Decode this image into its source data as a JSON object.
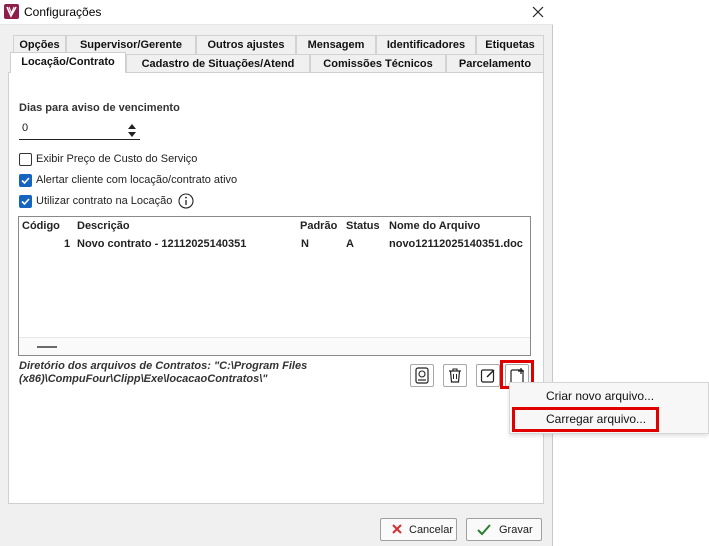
{
  "window": {
    "title": "Configurações"
  },
  "tabs": {
    "row1": [
      "Opções",
      "Supervisor/Gerente",
      "Outros ajustes",
      "Mensagem",
      "Identificadores",
      "Etiquetas"
    ],
    "row2": [
      "Locação/Contrato",
      "Cadastro de Situações/Atend",
      "Comissões Técnicos",
      "Parcelamento"
    ],
    "active": "Locação/Contrato"
  },
  "form": {
    "dias_label": "Dias para aviso de vencimento",
    "dias_value": "0",
    "checkboxes": [
      {
        "label": "Exibir Preço de Custo do Serviço",
        "checked": false
      },
      {
        "label": "Alertar cliente com locação/contrato ativo",
        "checked": true
      },
      {
        "label": "Utilizar contrato na Locação",
        "checked": true
      }
    ]
  },
  "grid": {
    "headers": [
      "Código",
      "Descrição",
      "Padrão",
      "Status",
      "Nome do Arquivo"
    ],
    "rows": [
      {
        "codigo": "1",
        "descricao": "Novo contrato - 12112025140351",
        "padrao": "N",
        "status": "A",
        "arquivo": "novo12112025140351.doc"
      }
    ]
  },
  "directory": {
    "text": "Diretório dos arquivos de Contratos: \"C:\\Program Files (x86)\\CompuFour\\Clipp\\Exe\\locacaoContratos\\\""
  },
  "toolbar_icons": [
    "view-document-icon",
    "trash-icon",
    "edit-icon",
    "add-file-icon"
  ],
  "context_menu": {
    "items": [
      "Criar novo arquivo...",
      "Carregar arquivo..."
    ]
  },
  "footer": {
    "cancel_label": "Cancelar",
    "save_label": "Gravar"
  },
  "colors": {
    "accent_blue": "#1565c0",
    "highlight_red": "#e00000",
    "cancel_red": "#d32f2f",
    "save_green": "#2e7d32"
  }
}
